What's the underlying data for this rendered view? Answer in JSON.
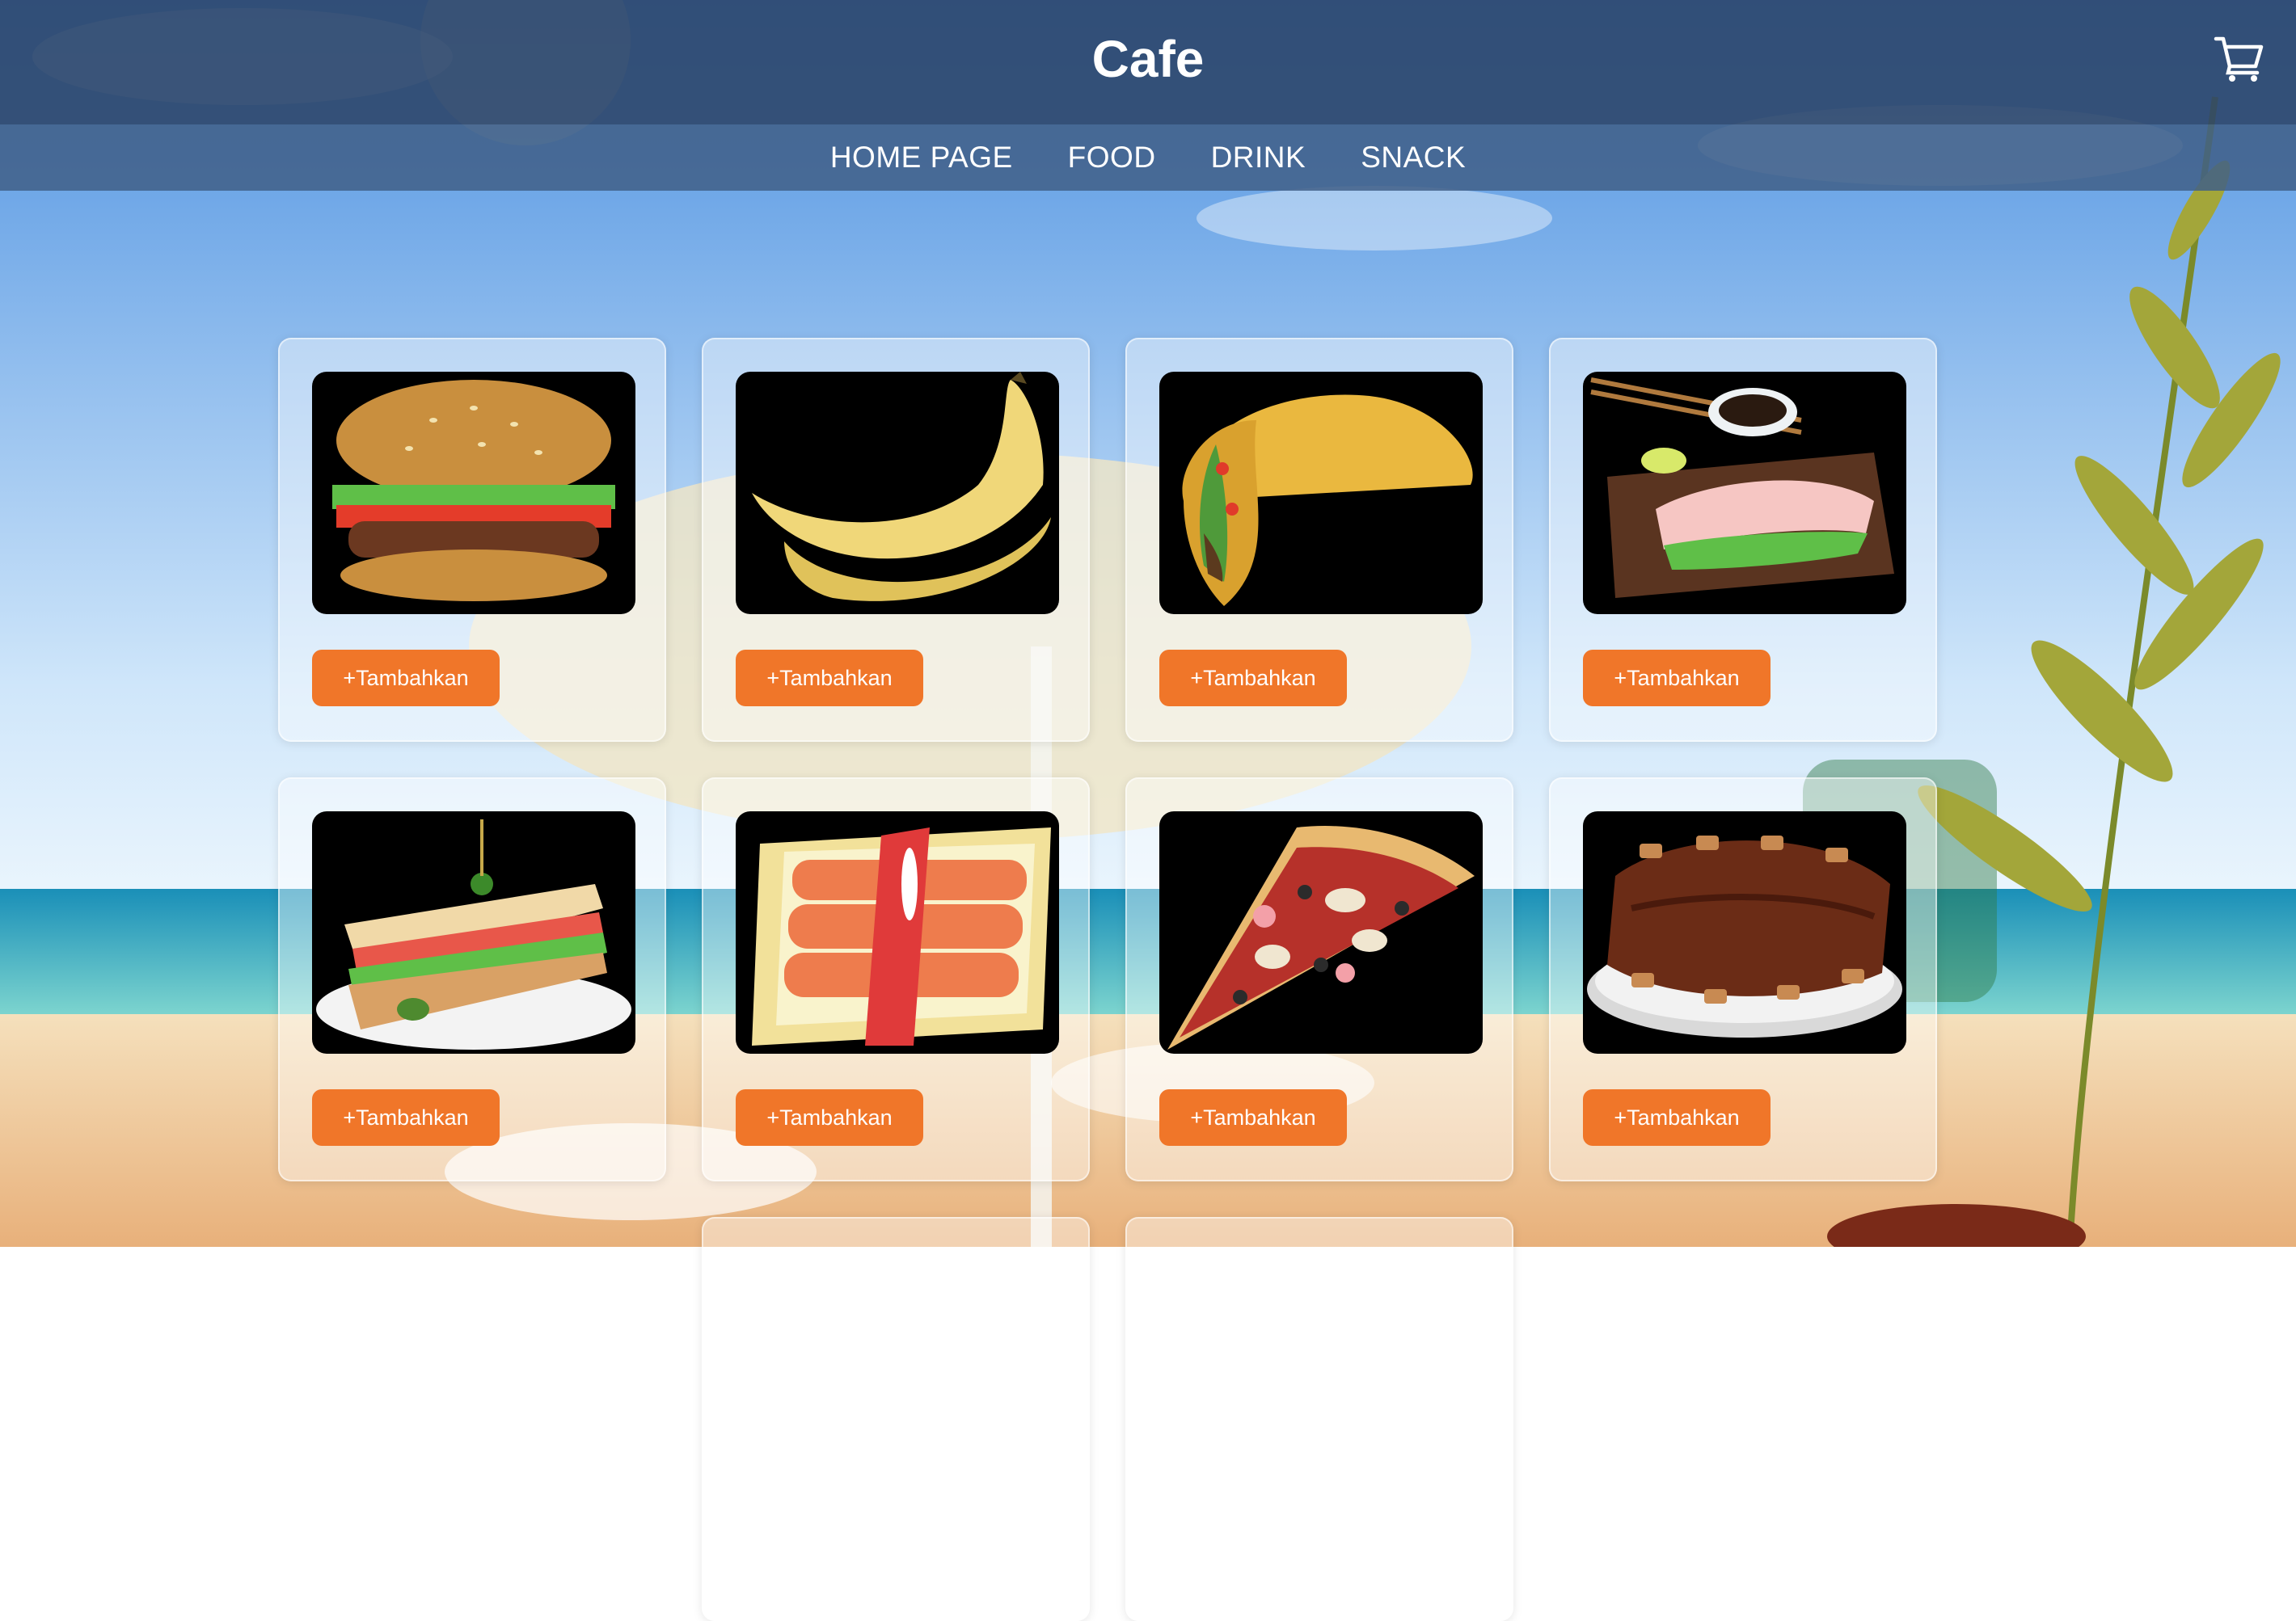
{
  "header": {
    "title": "Cafe"
  },
  "nav": {
    "items": [
      "HOME PAGE",
      "FOOD",
      "DRINK",
      "SNACK"
    ]
  },
  "products": [
    {
      "image": "burger",
      "button_label": "+Tambahkan"
    },
    {
      "image": "banana",
      "button_label": "+Tambahkan"
    },
    {
      "image": "taco",
      "button_label": "+Tambahkan"
    },
    {
      "image": "sashimi",
      "button_label": "+Tambahkan"
    },
    {
      "image": "club-sandwich",
      "button_label": "+Tambahkan"
    },
    {
      "image": "sushi-tray",
      "button_label": "+Tambahkan"
    },
    {
      "image": "pizza-slice",
      "button_label": "+Tambahkan"
    },
    {
      "image": "bbq-ribs",
      "button_label": "+Tambahkan"
    }
  ],
  "colors": {
    "accent": "#f07629",
    "header": "#2d4669",
    "nav": "#415f87"
  }
}
